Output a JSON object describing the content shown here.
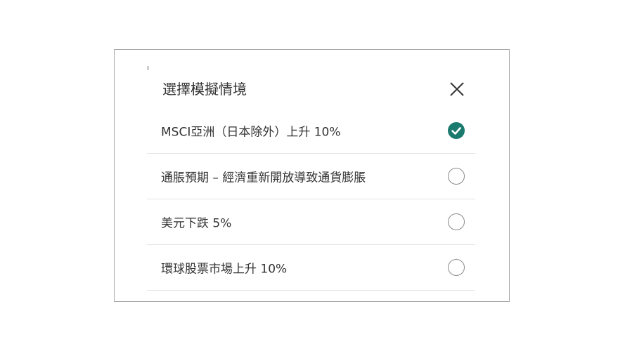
{
  "dialog": {
    "title": "選擇模擬情境",
    "close_icon": "close-icon",
    "accent_color": "#1a7a6e",
    "options": [
      {
        "label": "MSCI亞洲（日本除外）上升 10%",
        "selected": true
      },
      {
        "label": "通脹預期 – 經濟重新開放導致通貨膨脹",
        "selected": false
      },
      {
        "label": "美元下跌 5%",
        "selected": false
      },
      {
        "label": "環球股票市場上升 10%",
        "selected": false
      }
    ]
  }
}
